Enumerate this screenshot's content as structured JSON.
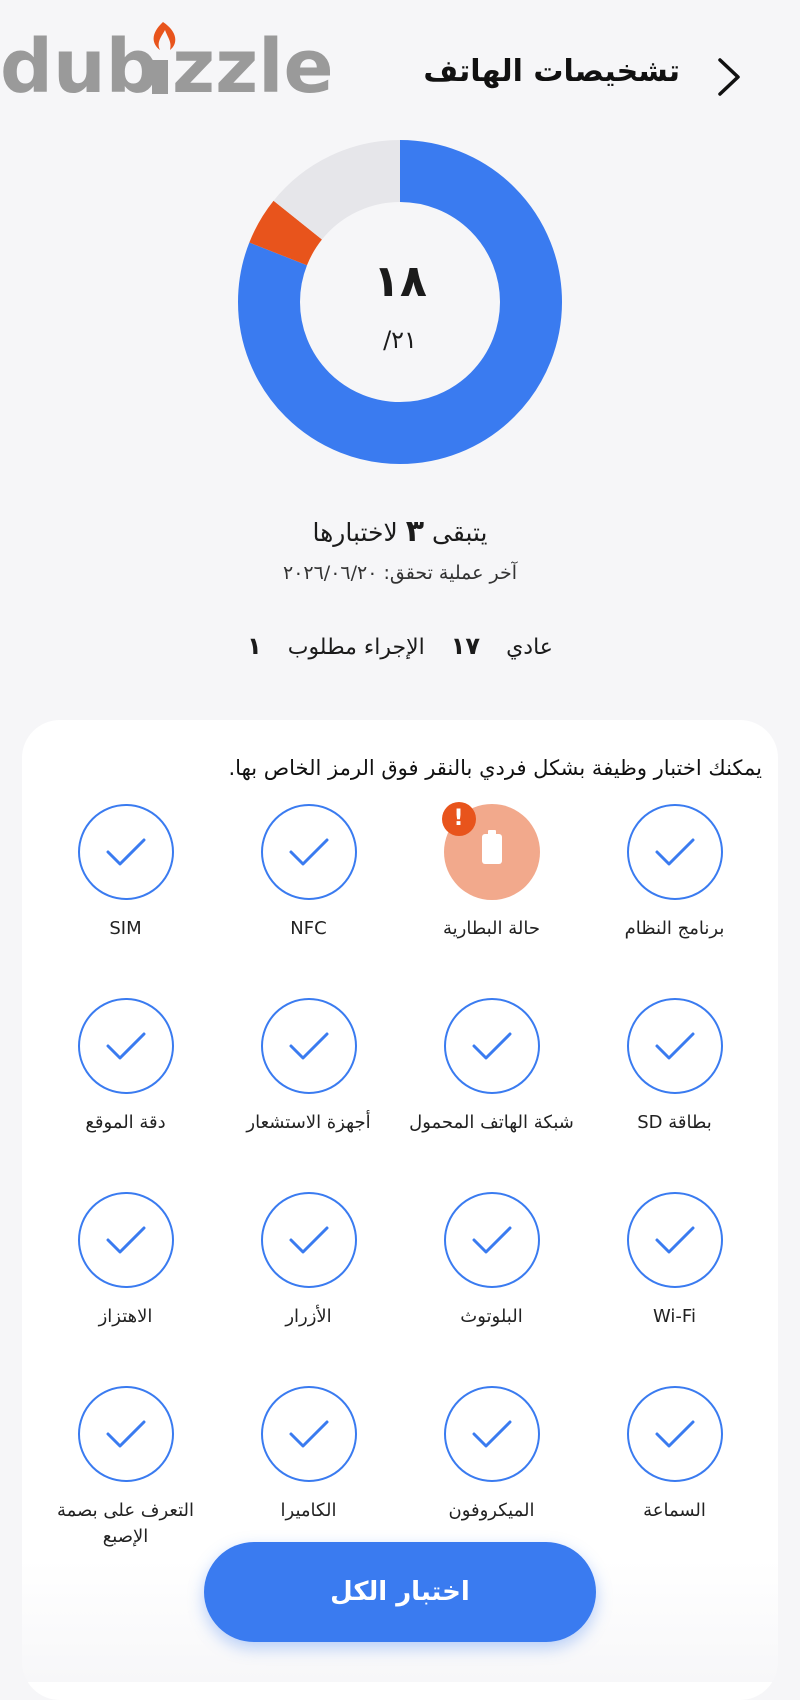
{
  "watermark": {
    "logo_text": "dubizzle"
  },
  "header": {
    "title": "تشخيصات الهاتف",
    "back_icon": "chevron-right-icon"
  },
  "score": {
    "passed": "١٨",
    "total": "/٢١",
    "segments": {
      "normal": 17,
      "action_required": 1,
      "remaining": 3,
      "total": 21
    },
    "colors": {
      "normal": "#3a7bf0",
      "action_required": "#e8541c",
      "remaining": "#e6e6ea"
    }
  },
  "status": {
    "remaining_prefix": "يتبقى",
    "remaining_count": "٣",
    "remaining_suffix": "لاختبارها",
    "last_check": "آخر عملية تحقق: ٢٠٢٦/٠٦/٢٠"
  },
  "summary": {
    "normal_label": "عادي",
    "normal_count": "١٧",
    "action_label": "الإجراء مطلوب",
    "action_count": "١"
  },
  "panel": {
    "instruction": "يمكنك اختبار وظيفة بشكل فردي بالنقر فوق الرمز الخاص بها.",
    "items": [
      {
        "label": "برنامج النظام",
        "state": "ok"
      },
      {
        "label": "حالة البطارية",
        "state": "warning"
      },
      {
        "label": "NFC",
        "state": "ok"
      },
      {
        "label": "SIM",
        "state": "ok"
      },
      {
        "label": "بطاقة SD",
        "state": "ok"
      },
      {
        "label": "شبكة الهاتف المحمول",
        "state": "ok"
      },
      {
        "label": "أجهزة الاستشعار",
        "state": "ok"
      },
      {
        "label": "دقة الموقع",
        "state": "ok"
      },
      {
        "label": "Wi-Fi",
        "state": "ok"
      },
      {
        "label": "البلوتوث",
        "state": "ok"
      },
      {
        "label": "الأزرار",
        "state": "ok"
      },
      {
        "label": "الاهتزاز",
        "state": "ok"
      },
      {
        "label": "السماعة",
        "state": "ok"
      },
      {
        "label": "الميكروفون",
        "state": "ok"
      },
      {
        "label": "الكاميرا",
        "state": "ok"
      },
      {
        "label": "التعرف على بصمة الإصبع",
        "state": "ok"
      }
    ],
    "warning_badge": "!"
  },
  "footer": {
    "test_all_label": "اختبار الكل"
  }
}
